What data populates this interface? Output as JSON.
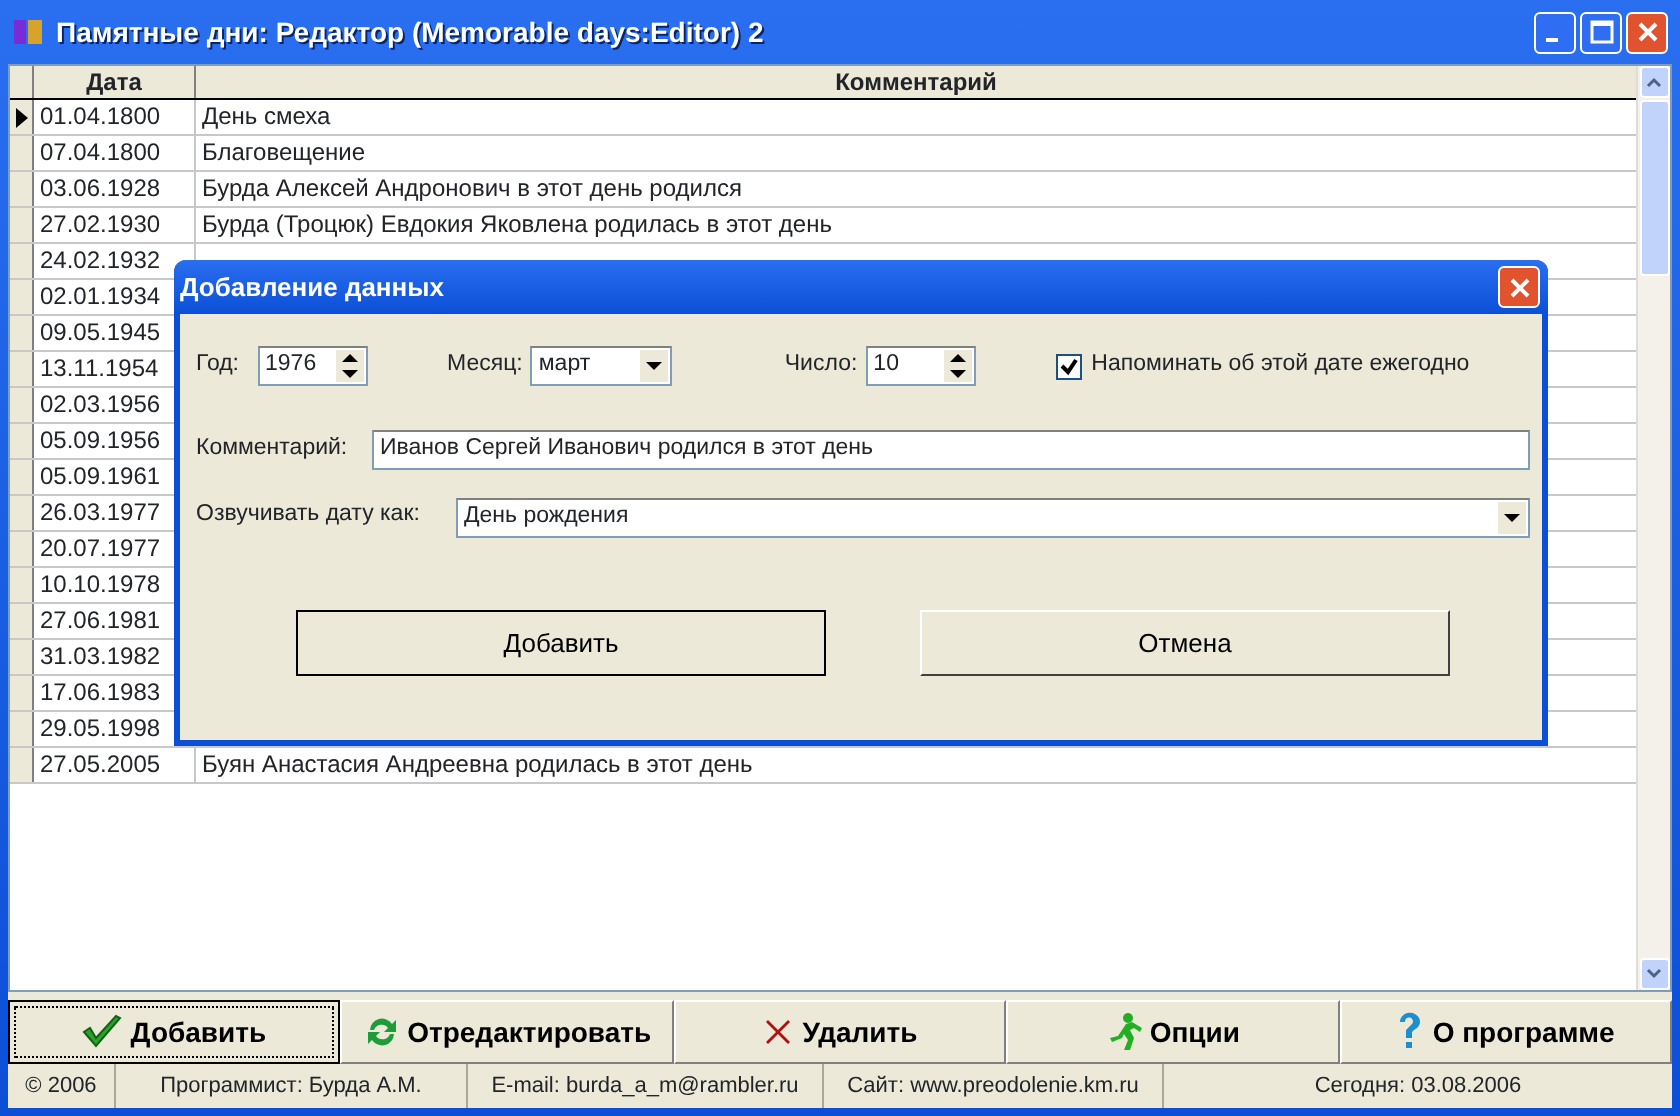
{
  "window": {
    "title": "Памятные дни: Редактор (Memorable days:Editor) 2"
  },
  "table": {
    "columns": [
      "Дата",
      "Комментарий"
    ],
    "rows": [
      {
        "date": "01.04.1800",
        "comment": "День смеха",
        "selected": true
      },
      {
        "date": "07.04.1800",
        "comment": "Благовещение",
        "selected": false
      },
      {
        "date": "03.06.1928",
        "comment": "Бурда Алексей Андронович в этот день родился",
        "selected": false
      },
      {
        "date": "27.02.1930",
        "comment": "Бурда (Троцюк) Евдокия Яковлена родилась в этот день",
        "selected": false
      },
      {
        "date": "24.02.1932",
        "selected": false
      },
      {
        "date": "02.01.1934",
        "selected": false
      },
      {
        "date": "09.05.1945",
        "selected": false
      },
      {
        "date": "13.11.1954",
        "selected": false
      },
      {
        "date": "02.03.1956",
        "selected": false
      },
      {
        "date": "05.09.1956",
        "selected": false
      },
      {
        "date": "05.09.1961",
        "selected": false
      },
      {
        "date": "26.03.1977",
        "selected": false
      },
      {
        "date": "20.07.1977",
        "selected": false
      },
      {
        "date": "10.10.1978",
        "selected": false
      },
      {
        "date": "27.06.1981",
        "selected": false
      },
      {
        "date": "31.03.1982",
        "selected": false
      },
      {
        "date": "17.06.1983",
        "selected": false
      },
      {
        "date": "29.05.1998",
        "selected": false
      },
      {
        "date": "27.05.2005",
        "comment": "Буян Анастасия Андреевна родилась в этот день",
        "selected": false
      }
    ]
  },
  "dialog": {
    "title": "Добавление данных",
    "year_label": "Год:",
    "year": "1976",
    "month_label": "Месяц:",
    "month": "март",
    "day_label": "Число:",
    "day": "10",
    "remind": {
      "label": "Напоминать об этой дате ежегодно",
      "checked": true
    },
    "comment_label": "Комментарий:",
    "comment": "Иванов Сергей Иванович родился в этот день",
    "announce_label": "Озвучивать дату как:",
    "announce": "День рождения",
    "buttons": [
      "Добавить",
      "Отмена"
    ]
  },
  "toolbar": [
    {
      "kind": "check",
      "label": "Добавить",
      "selected": true
    },
    {
      "kind": "refresh",
      "label": "Отредактировать",
      "selected": false
    },
    {
      "kind": "cross",
      "label": "Удалить",
      "selected": false
    },
    {
      "kind": "runner",
      "label": "Опции",
      "selected": false
    },
    {
      "kind": "help",
      "label": "О программе",
      "selected": false
    }
  ],
  "status_bar": [
    "© 2006",
    "Программист: Бурда А.М.",
    "E-mail:  burda_a_m@rambler.ru",
    "Сайт:  www.preodolenie.km.ru",
    "Сегодня: 03.08.2006"
  ]
}
